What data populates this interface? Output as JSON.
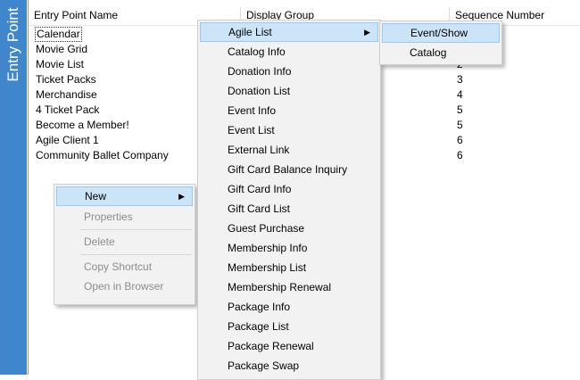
{
  "panel": {
    "title": "Entry Point"
  },
  "columns": [
    "Entry Point Name",
    "Display Group",
    "Sequence Number"
  ],
  "rows": [
    {
      "name": "Calendar",
      "seq": ""
    },
    {
      "name": "Movie Grid",
      "seq": ""
    },
    {
      "name": "Movie List",
      "seq": "2"
    },
    {
      "name": "Ticket Packs",
      "seq": "3"
    },
    {
      "name": "Merchandise",
      "seq": "4"
    },
    {
      "name": "4 Ticket Pack",
      "seq": "5"
    },
    {
      "name": "Become a Member!",
      "seq": "5"
    },
    {
      "name": "Agile Client 1",
      "seq": "6"
    },
    {
      "name": "Community Ballet Company",
      "seq": "6"
    }
  ],
  "context_menu": {
    "new": "New",
    "properties": "Properties",
    "delete": "Delete",
    "copy_shortcut": "Copy Shortcut",
    "open_in_browser": "Open in Browser"
  },
  "new_submenu": {
    "items": [
      "Agile List",
      "Catalog Info",
      "Donation Info",
      "Donation List",
      "Event Info",
      "Event List",
      "External Link",
      "Gift Card Balance Inquiry",
      "Gift Card Info",
      "Gift Card List",
      "Guest Purchase",
      "Membership Info",
      "Membership List",
      "Membership Renewal",
      "Package Info",
      "Package List",
      "Package Renewal",
      "Package Swap"
    ]
  },
  "agile_submenu": {
    "items": [
      "Event/Show",
      "Catalog"
    ]
  },
  "icons": {
    "submenu_arrow": "chevron-right-icon"
  }
}
